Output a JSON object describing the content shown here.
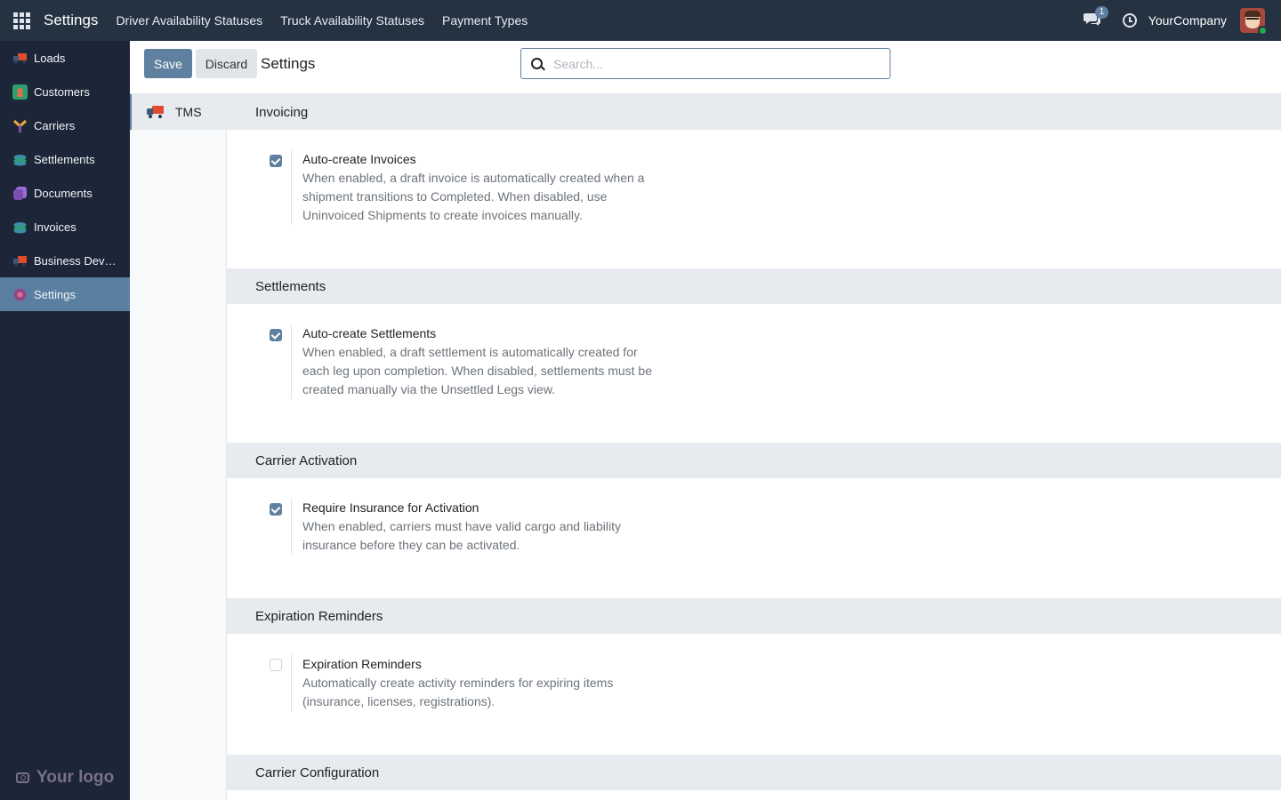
{
  "app": {
    "title": "Settings",
    "menu": [
      "Driver Availability Statuses",
      "Truck Availability Statuses",
      "Payment Types"
    ],
    "chat_count": "1",
    "company": "YourCompany"
  },
  "sidebar": {
    "items": [
      {
        "label": "Loads",
        "icon": "loads-icon",
        "active": false
      },
      {
        "label": "Customers",
        "icon": "customers-icon",
        "active": false
      },
      {
        "label": "Carriers",
        "icon": "carriers-icon",
        "active": false
      },
      {
        "label": "Settlements",
        "icon": "settlements-icon",
        "active": false
      },
      {
        "label": "Documents",
        "icon": "documents-icon",
        "active": false
      },
      {
        "label": "Invoices",
        "icon": "invoices-icon",
        "active": false
      },
      {
        "label": "Business Dev…",
        "icon": "business-dev-icon",
        "active": false
      },
      {
        "label": "Settings",
        "icon": "settings-icon",
        "active": true
      }
    ],
    "logo_text": "Your logo"
  },
  "control": {
    "save_label": "Save",
    "discard_label": "Discard",
    "breadcrumb": "Settings",
    "search_placeholder": "Search..."
  },
  "settings_tabs": [
    {
      "label": "TMS",
      "icon": "truck-icon",
      "active": true
    }
  ],
  "sections": [
    {
      "title": "Invoicing",
      "setting": {
        "checked": true,
        "label": "Auto-create Invoices",
        "desc_lines": [
          "When enabled, a draft invoice is automatically created when a",
          "shipment transitions to Completed. When disabled, use",
          "Uninvoiced Shipments to create invoices manually."
        ]
      }
    },
    {
      "title": "Settlements",
      "setting": {
        "checked": true,
        "label": "Auto-create Settlements",
        "desc_lines": [
          "When enabled, a draft settlement is automatically created for",
          "each leg upon completion. When disabled, settlements must be",
          "created manually via the Unsettled Legs view."
        ]
      }
    },
    {
      "title": "Carrier Activation",
      "setting": {
        "checked": true,
        "label": "Require Insurance for Activation",
        "desc_lines": [
          "When enabled, carriers must have valid cargo and liability",
          "insurance before they can be activated."
        ]
      }
    },
    {
      "title": "Expiration Reminders",
      "setting": {
        "checked": false,
        "label": "Expiration Reminders",
        "desc_lines": [
          "Automatically create activity reminders for expiring items",
          "(insurance, licenses, registrations)."
        ]
      }
    },
    {
      "title": "Carrier Configuration"
    }
  ],
  "colors": {
    "navbar": "#243242",
    "sidebar": "#1c2638",
    "accent": "#5f819f"
  }
}
